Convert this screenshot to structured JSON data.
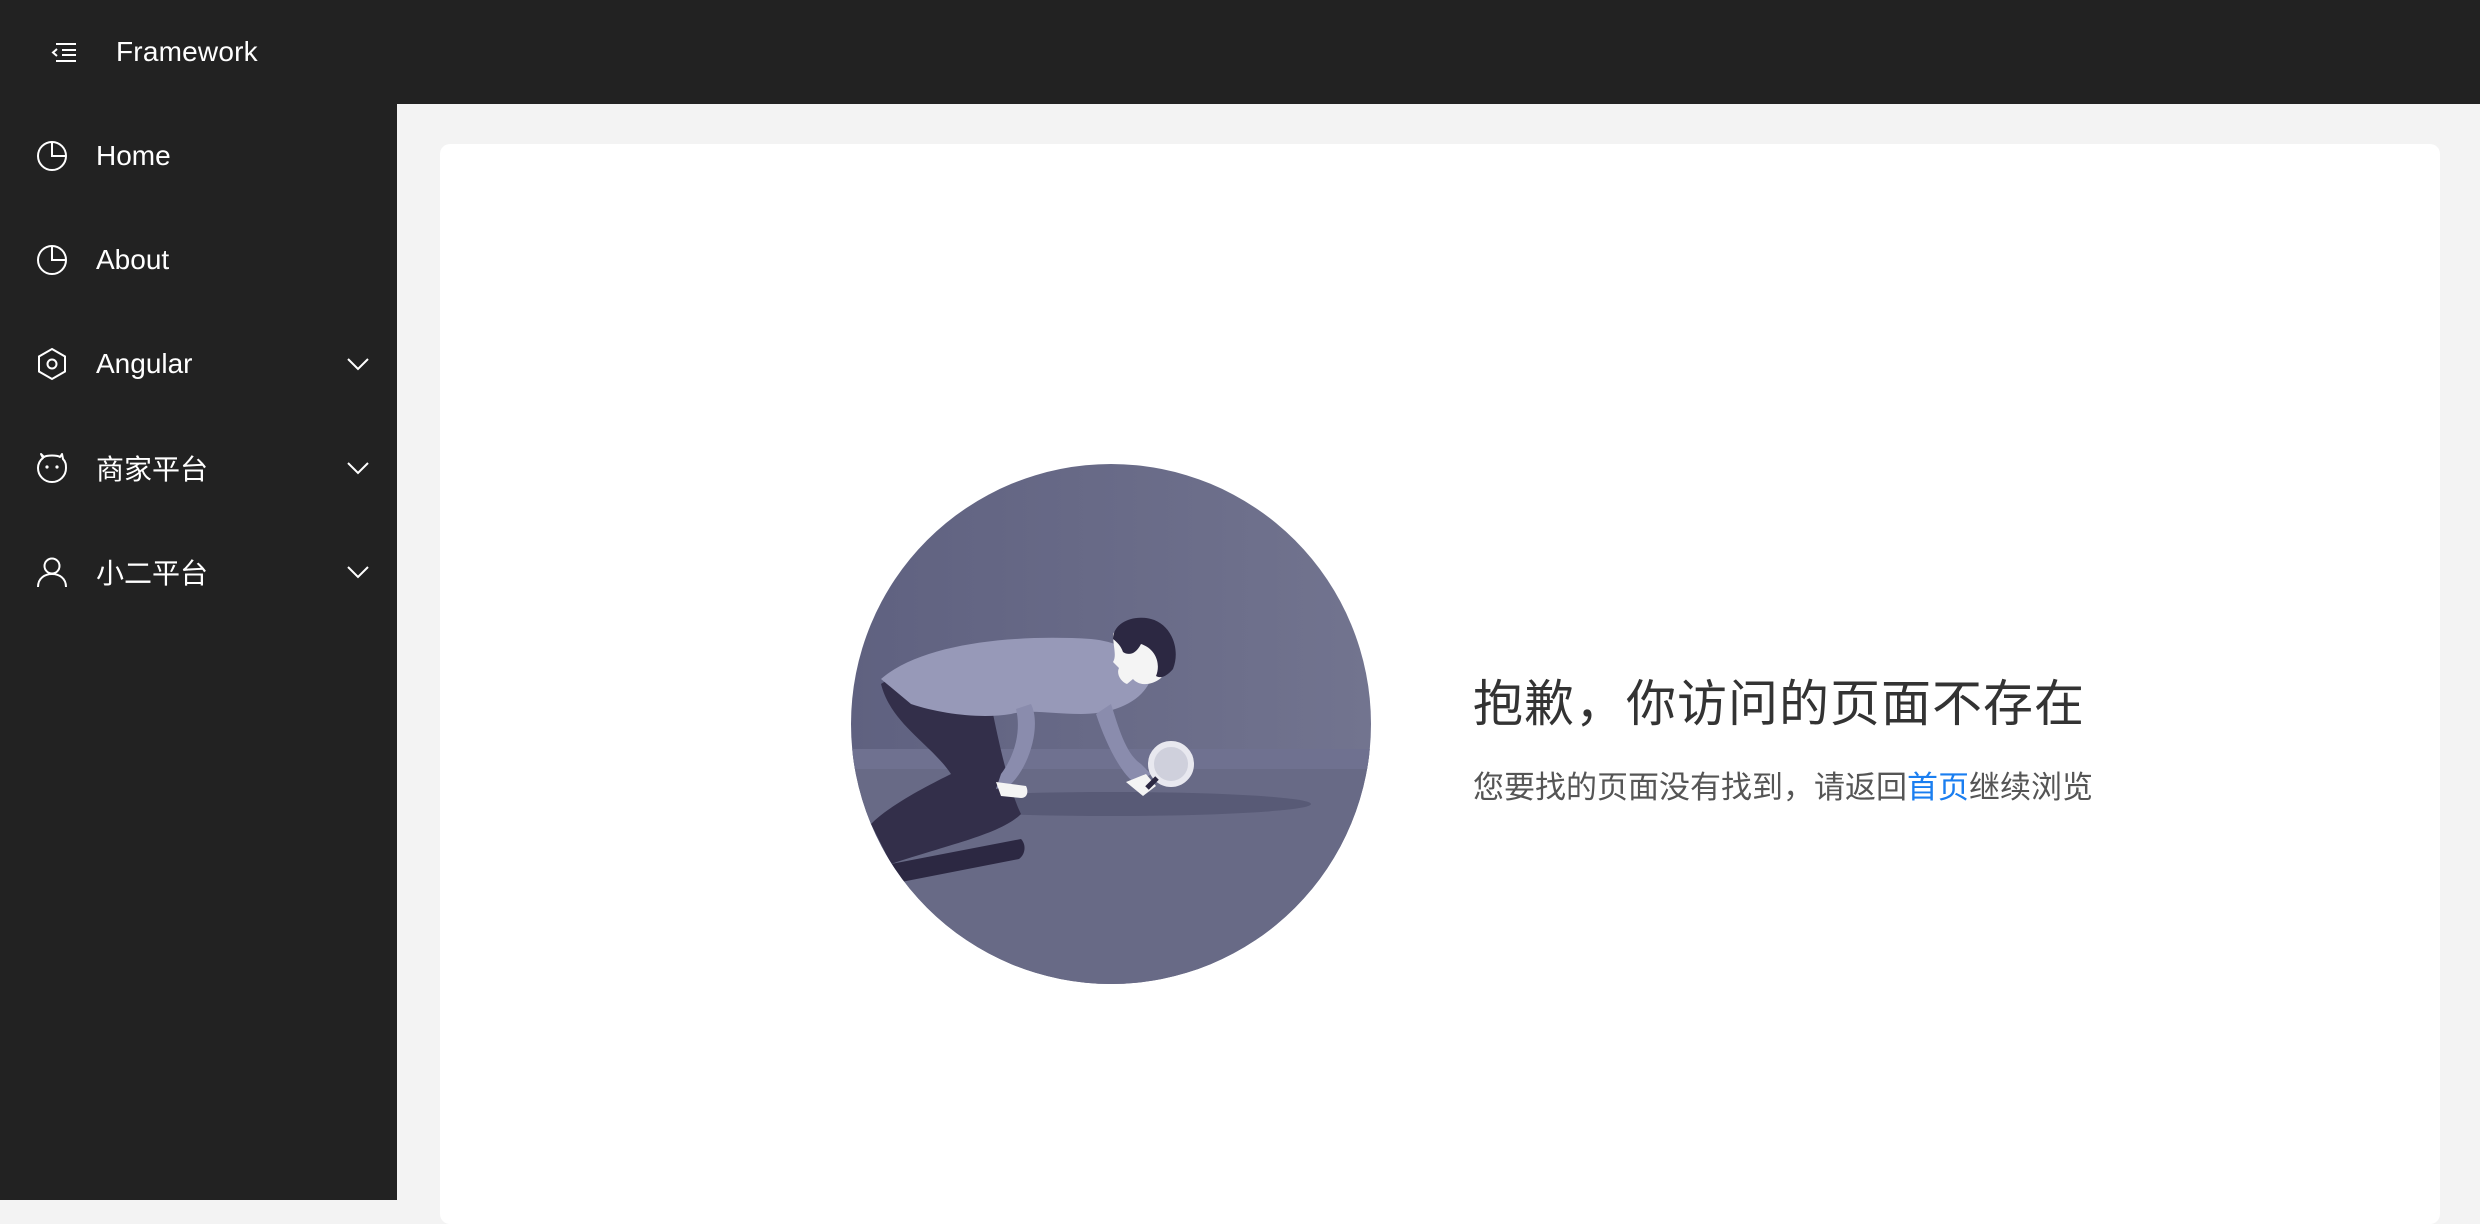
{
  "header": {
    "app_title": "Framework",
    "menu_toggle_icon": "menu-fold-icon"
  },
  "sidebar": {
    "items": [
      {
        "label": "Home",
        "icon": "pie-chart-icon",
        "expandable": false
      },
      {
        "label": "About",
        "icon": "pie-chart-icon",
        "expandable": false
      },
      {
        "label": "Angular",
        "icon": "hexagon-settings-icon",
        "expandable": true
      },
      {
        "label": "商家平台",
        "icon": "smile-face-icon",
        "expandable": true
      },
      {
        "label": "小二平台",
        "icon": "user-icon",
        "expandable": true
      }
    ]
  },
  "error_page": {
    "title": "抱歉，你访问的页面不存在",
    "desc_before": "您要找的页面没有找到，请返回",
    "home_link": "首页",
    "desc_after": "继续浏览"
  },
  "colors": {
    "sidebar_bg": "#222222",
    "header_bg": "#222222",
    "link": "#1a7ef0",
    "illustration_bg": "#676a85"
  }
}
